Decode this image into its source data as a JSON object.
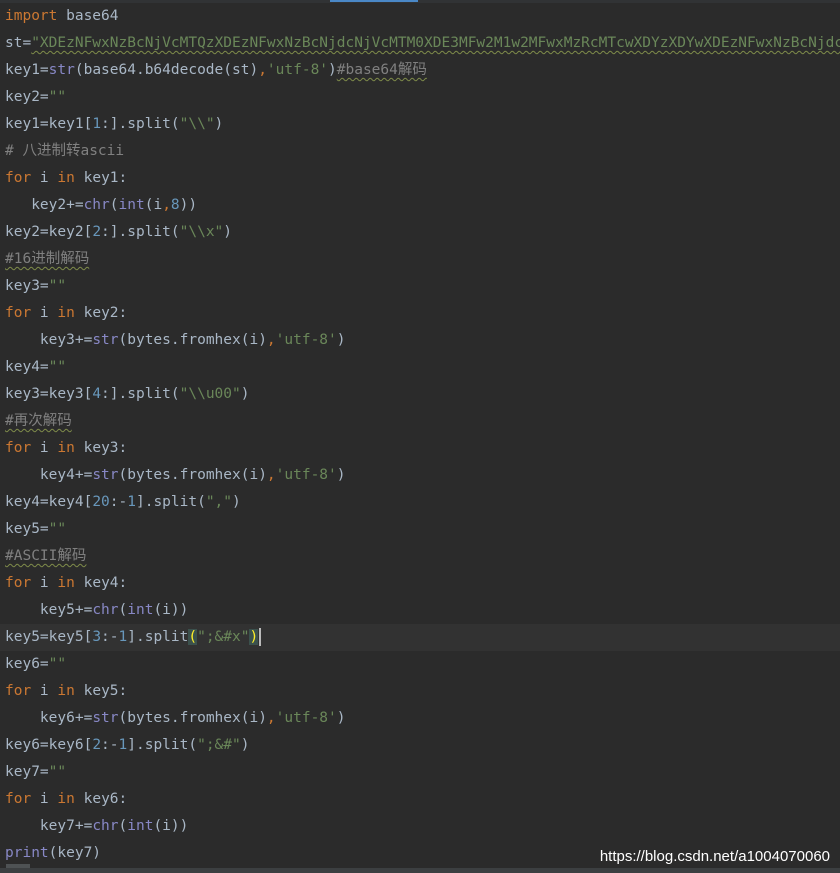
{
  "lines": [
    [
      {
        "t": "import",
        "c": "kw"
      },
      {
        "t": " base64",
        "c": ""
      }
    ],
    [
      {
        "t": "st=",
        "c": ""
      },
      {
        "t": "\"XDEzNFwxNzBcNjVcMTQzXDEzNFwxNzBcNjdcNjVcMTM0XDE3MFw2M1w2MFwxMzRcMTcwXDYzXDYwXDEzNFwxNzBcNjdcNjZc",
        "c": "str wavy"
      }
    ],
    [
      {
        "t": "key1=",
        "c": ""
      },
      {
        "t": "str",
        "c": "bi"
      },
      {
        "t": "(base64.b64decode(st)",
        "c": ""
      },
      {
        "t": ",",
        "c": "kw"
      },
      {
        "t": "'utf-8'",
        "c": "str"
      },
      {
        "t": ")",
        "c": ""
      },
      {
        "t": "#base64解码",
        "c": "com wavy"
      }
    ],
    [
      {
        "t": "key2=",
        "c": ""
      },
      {
        "t": "\"\"",
        "c": "str"
      }
    ],
    [
      {
        "t": "key1=key1[",
        "c": ""
      },
      {
        "t": "1",
        "c": "num"
      },
      {
        "t": ":].split(",
        "c": ""
      },
      {
        "t": "\"\\\\\"",
        "c": "str"
      },
      {
        "t": ")",
        "c": ""
      }
    ],
    [
      {
        "t": "# 八进制转ascii",
        "c": "com"
      }
    ],
    [
      {
        "t": "for",
        "c": "kw"
      },
      {
        "t": " i ",
        "c": ""
      },
      {
        "t": "in",
        "c": "kw"
      },
      {
        "t": " key1:",
        "c": ""
      }
    ],
    [
      {
        "t": "   key2+=",
        "c": ""
      },
      {
        "t": "chr",
        "c": "bi"
      },
      {
        "t": "(",
        "c": ""
      },
      {
        "t": "int",
        "c": "bi"
      },
      {
        "t": "(i",
        "c": ""
      },
      {
        "t": ",",
        "c": "kw"
      },
      {
        "t": "8",
        "c": "num"
      },
      {
        "t": "))",
        "c": ""
      }
    ],
    [
      {
        "t": "key2=key2[",
        "c": ""
      },
      {
        "t": "2",
        "c": "num"
      },
      {
        "t": ":].split(",
        "c": ""
      },
      {
        "t": "\"\\\\x\"",
        "c": "str"
      },
      {
        "t": ")",
        "c": ""
      }
    ],
    [
      {
        "t": "#16进制解码",
        "c": "com wavy"
      }
    ],
    [
      {
        "t": "key3=",
        "c": ""
      },
      {
        "t": "\"\"",
        "c": "str"
      }
    ],
    [
      {
        "t": "for",
        "c": "kw"
      },
      {
        "t": " i ",
        "c": ""
      },
      {
        "t": "in",
        "c": "kw"
      },
      {
        "t": " key2:",
        "c": ""
      }
    ],
    [
      {
        "t": "    key3+=",
        "c": ""
      },
      {
        "t": "str",
        "c": "bi"
      },
      {
        "t": "(bytes.fromhex(i)",
        "c": ""
      },
      {
        "t": ",",
        "c": "kw"
      },
      {
        "t": "'utf-8'",
        "c": "str"
      },
      {
        "t": ")",
        "c": ""
      }
    ],
    [
      {
        "t": "key4=",
        "c": ""
      },
      {
        "t": "\"\"",
        "c": "str"
      }
    ],
    [
      {
        "t": "key3=key3[",
        "c": ""
      },
      {
        "t": "4",
        "c": "num"
      },
      {
        "t": ":].split(",
        "c": ""
      },
      {
        "t": "\"\\\\u00\"",
        "c": "str"
      },
      {
        "t": ")",
        "c": ""
      }
    ],
    [
      {
        "t": "#再次解码",
        "c": "com wavy"
      }
    ],
    [
      {
        "t": "for",
        "c": "kw"
      },
      {
        "t": " i ",
        "c": ""
      },
      {
        "t": "in",
        "c": "kw"
      },
      {
        "t": " key3:",
        "c": ""
      }
    ],
    [
      {
        "t": "    key4+=",
        "c": ""
      },
      {
        "t": "str",
        "c": "bi"
      },
      {
        "t": "(bytes.fromhex(i)",
        "c": ""
      },
      {
        "t": ",",
        "c": "kw"
      },
      {
        "t": "'utf-8'",
        "c": "str"
      },
      {
        "t": ")",
        "c": ""
      }
    ],
    [
      {
        "t": "key4=key4[",
        "c": ""
      },
      {
        "t": "20",
        "c": "num"
      },
      {
        "t": ":-",
        "c": ""
      },
      {
        "t": "1",
        "c": "num"
      },
      {
        "t": "].split(",
        "c": ""
      },
      {
        "t": "\",\"",
        "c": "str"
      },
      {
        "t": ")",
        "c": ""
      }
    ],
    [
      {
        "t": "key5=",
        "c": ""
      },
      {
        "t": "\"\"",
        "c": "str"
      }
    ],
    [
      {
        "t": "#ASCII解码",
        "c": "com wavy"
      }
    ],
    [
      {
        "t": "for",
        "c": "kw"
      },
      {
        "t": " i ",
        "c": ""
      },
      {
        "t": "in",
        "c": "kw"
      },
      {
        "t": " key4:",
        "c": ""
      }
    ],
    [
      {
        "t": "    key5+=",
        "c": ""
      },
      {
        "t": "chr",
        "c": "bi"
      },
      {
        "t": "(",
        "c": ""
      },
      {
        "t": "int",
        "c": "bi"
      },
      {
        "t": "(i))",
        "c": ""
      }
    ],
    [
      {
        "t": "key5=key5[",
        "c": ""
      },
      {
        "t": "3",
        "c": "num"
      },
      {
        "t": ":-",
        "c": ""
      },
      {
        "t": "1",
        "c": "num"
      },
      {
        "t": "].split",
        "c": ""
      },
      {
        "t": "(",
        "c": "brk-hl"
      },
      {
        "t": "\";&#x\"",
        "c": "str"
      },
      {
        "t": ")",
        "c": "brk-hl"
      },
      {
        "t": "",
        "c": "caret"
      }
    ],
    [
      {
        "t": "key6=",
        "c": ""
      },
      {
        "t": "\"\"",
        "c": "str"
      }
    ],
    [
      {
        "t": "for",
        "c": "kw"
      },
      {
        "t": " i ",
        "c": ""
      },
      {
        "t": "in",
        "c": "kw"
      },
      {
        "t": " key5:",
        "c": ""
      }
    ],
    [
      {
        "t": "    key6+=",
        "c": ""
      },
      {
        "t": "str",
        "c": "bi"
      },
      {
        "t": "(bytes.fromhex(i)",
        "c": ""
      },
      {
        "t": ",",
        "c": "kw"
      },
      {
        "t": "'utf-8'",
        "c": "str"
      },
      {
        "t": ")",
        "c": ""
      }
    ],
    [
      {
        "t": "key6=key6[",
        "c": ""
      },
      {
        "t": "2",
        "c": "num"
      },
      {
        "t": ":-",
        "c": ""
      },
      {
        "t": "1",
        "c": "num"
      },
      {
        "t": "].split(",
        "c": ""
      },
      {
        "t": "\";&#\"",
        "c": "str"
      },
      {
        "t": ")",
        "c": ""
      }
    ],
    [
      {
        "t": "key7=",
        "c": ""
      },
      {
        "t": "\"\"",
        "c": "str"
      }
    ],
    [
      {
        "t": "for",
        "c": "kw"
      },
      {
        "t": " i ",
        "c": ""
      },
      {
        "t": "in",
        "c": "kw"
      },
      {
        "t": " key6:",
        "c": ""
      }
    ],
    [
      {
        "t": "    key7+=",
        "c": ""
      },
      {
        "t": "chr",
        "c": "bi"
      },
      {
        "t": "(",
        "c": ""
      },
      {
        "t": "int",
        "c": "bi"
      },
      {
        "t": "(i))",
        "c": ""
      }
    ],
    [
      {
        "t": "print",
        "c": "bi"
      },
      {
        "t": "(key7)",
        "c": ""
      }
    ]
  ],
  "current_line": 23,
  "watermark": "https://blog.csdn.net/a1004070060",
  "colors": {
    "background": "#2b2b2b",
    "keyword": "#cc7832",
    "string": "#6a8759",
    "number": "#6897bb",
    "comment": "#808080",
    "builtin": "#8888c6",
    "default": "#a9b7c6"
  }
}
